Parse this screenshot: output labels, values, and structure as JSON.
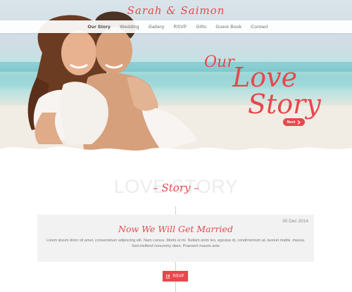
{
  "brand": {
    "title": "Sarah & Saimon"
  },
  "nav": {
    "items": [
      "Our Story",
      "Wedding",
      "Gallery",
      "RSVP",
      "Gifts",
      "Guest Book",
      "Contact"
    ],
    "active_index": 0
  },
  "hero": {
    "title_line1": "Our",
    "title_line2": "Love",
    "title_line3": "Story",
    "next_label": "Next",
    "next_icon": "chevron-right-icon"
  },
  "story": {
    "background_word": "LOVE STORY",
    "heading": "– Story –",
    "card": {
      "date": "30 Dec 2014",
      "title": "Now We Will Get Married",
      "text": "Lorem ipsum dolor sit amel, consectetuer adipiscing elit. Nam cursus. Morbi ut mi. Nullam enim leo, egestas id, condimentum at, laoreet mattis, massa. Sed eleifend nonummy diam. Praesent mauris ante"
    },
    "rsvp_label": "RSVP",
    "rsvp_icon": "edit-icon"
  },
  "colors": {
    "accent": "#e8474c",
    "card_bg": "#f2f2f2",
    "nav_text": "#666666"
  }
}
